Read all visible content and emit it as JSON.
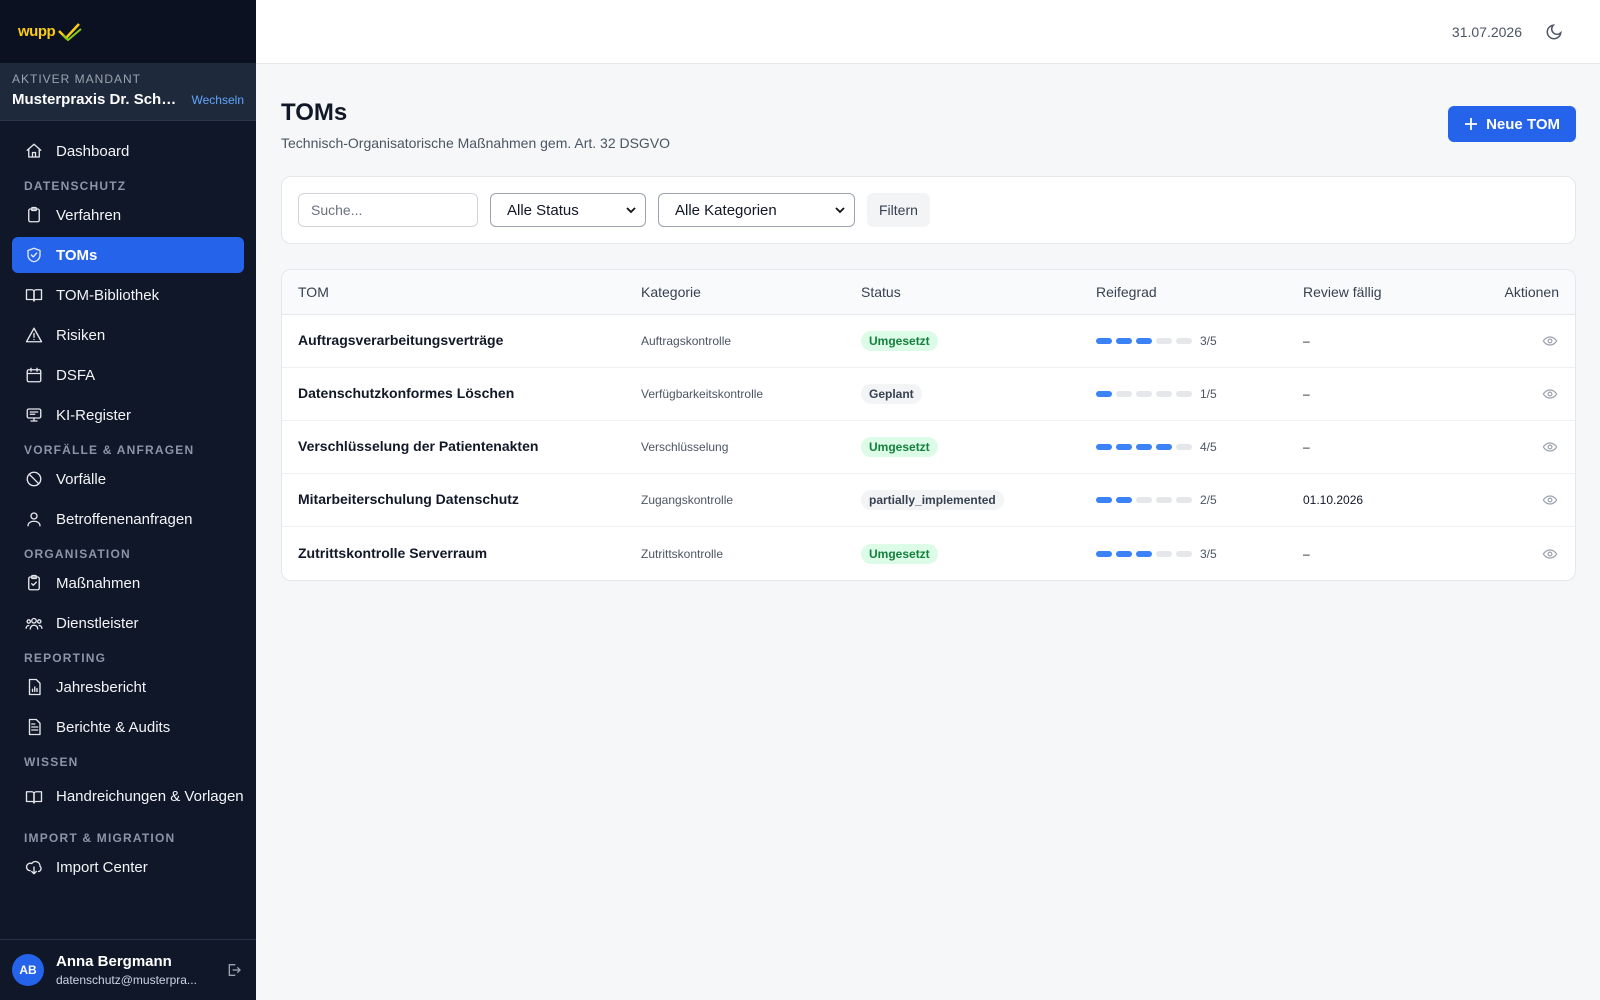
{
  "brand": {
    "logo_text": "wupp",
    "accent": "#2563eb",
    "sidebar_bg": "#0f1729"
  },
  "tenant": {
    "label": "AKTIVER MANDANT",
    "name": "Musterpraxis Dr. Schmi...",
    "switch_label": "Wechseln"
  },
  "nav": {
    "dashboard": {
      "label": "Dashboard",
      "icon": "home-icon"
    },
    "sections": [
      {
        "title": "DATENSCHUTZ",
        "items": [
          {
            "label": "Verfahren",
            "icon": "clipboard-icon"
          },
          {
            "label": "TOMs",
            "icon": "shield-check-icon",
            "active": true
          },
          {
            "label": "TOM-Bibliothek",
            "icon": "book-icon"
          },
          {
            "label": "Risiken",
            "icon": "warning-icon"
          },
          {
            "label": "DSFA",
            "icon": "calendar-icon"
          },
          {
            "label": "KI-Register",
            "icon": "monitor-icon"
          }
        ]
      },
      {
        "title": "VORFÄLLE & ANFRAGEN",
        "items": [
          {
            "label": "Vorfälle",
            "icon": "ban-icon"
          },
          {
            "label": "Betroffenenanfragen",
            "icon": "user-icon"
          }
        ]
      },
      {
        "title": "ORGANISATION",
        "items": [
          {
            "label": "Maßnahmen",
            "icon": "clipboard-check-icon"
          },
          {
            "label": "Dienstleister",
            "icon": "users-icon"
          }
        ]
      },
      {
        "title": "REPORTING",
        "items": [
          {
            "label": "Jahresbericht",
            "icon": "report-chart-icon"
          },
          {
            "label": "Berichte & Audits",
            "icon": "document-icon"
          }
        ]
      },
      {
        "title": "WISSEN",
        "items": [
          {
            "label": "Handreichungen & Vorlagen",
            "icon": "book-open-icon"
          }
        ]
      },
      {
        "title": "IMPORT & MIGRATION",
        "items": [
          {
            "label": "Import Center",
            "icon": "cloud-download-icon"
          }
        ]
      }
    ]
  },
  "user": {
    "initials": "AB",
    "name": "Anna Bergmann",
    "email": "datenschutz@musterpra..."
  },
  "topbar": {
    "date": "31.07.2026"
  },
  "page": {
    "title": "TOMs",
    "subtitle": "Technisch-Organisatorische Maßnahmen gem. Art. 32 DSGVO",
    "new_button": "Neue TOM"
  },
  "filters": {
    "search_placeholder": "Suche...",
    "status_value": "Alle Status",
    "category_value": "Alle Kategorien",
    "filter_button": "Filtern"
  },
  "table": {
    "headers": {
      "tom": "TOM",
      "kategorie": "Kategorie",
      "status": "Status",
      "reifegrad": "Reifegrad",
      "review": "Review fällig",
      "aktionen": "Aktionen"
    },
    "rows": [
      {
        "name": "Auftragsverarbeitungsverträge",
        "kategorie": "Auftragskontrolle",
        "status": "Umgesetzt",
        "status_color": "green",
        "maturity": 3,
        "maturity_text": "3/5",
        "review": "–"
      },
      {
        "name": "Datenschutzkonformes Löschen",
        "kategorie": "Verfügbarkeitskontrolle",
        "status": "Geplant",
        "status_color": "gray",
        "maturity": 1,
        "maturity_text": "1/5",
        "review": "–"
      },
      {
        "name": "Verschlüsselung der Patientenakten",
        "kategorie": "Verschlüsselung",
        "status": "Umgesetzt",
        "status_color": "green",
        "maturity": 4,
        "maturity_text": "4/5",
        "review": "–"
      },
      {
        "name": "Mitarbeiterschulung Datenschutz",
        "kategorie": "Zugangskontrolle",
        "status": "partially_implemented",
        "status_color": "gray",
        "maturity": 2,
        "maturity_text": "2/5",
        "review": "01.10.2026"
      },
      {
        "name": "Zutrittskontrolle Serverraum",
        "kategorie": "Zutrittskontrolle",
        "status": "Umgesetzt",
        "status_color": "green",
        "maturity": 3,
        "maturity_text": "3/5",
        "review": "–"
      }
    ]
  }
}
